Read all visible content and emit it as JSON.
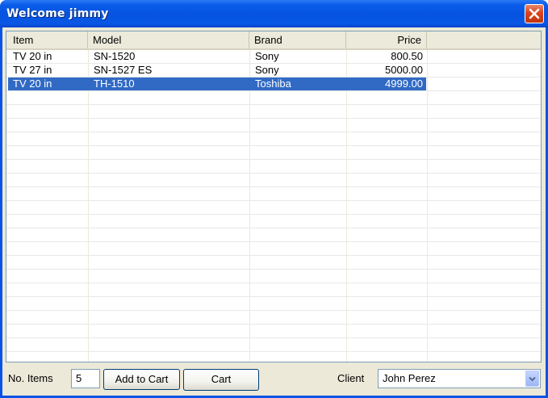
{
  "window": {
    "title": "Welcome jimmy"
  },
  "table": {
    "columns": [
      "Item",
      "Model",
      "Brand",
      "Price"
    ],
    "rows": [
      {
        "item": "TV 20 in",
        "model": "SN-1520",
        "brand": "Sony",
        "price": "800.50",
        "selected": false
      },
      {
        "item": "TV 27 in",
        "model": "SN-1527 ES",
        "brand": "Sony",
        "price": "5000.00",
        "selected": false
      },
      {
        "item": "TV 20 in",
        "model": "TH-1510",
        "brand": "Toshiba",
        "price": "4999.00",
        "selected": true
      }
    ]
  },
  "form": {
    "items_label": "No. Items",
    "items_value": "5",
    "add_to_cart_label": "Add to Cart",
    "cart_label": "Cart",
    "client_label": "Client",
    "client_value": "John Perez"
  },
  "colors": {
    "selection": "#316ac5",
    "titlebar": "#0553e0",
    "close": "#d9431c"
  }
}
